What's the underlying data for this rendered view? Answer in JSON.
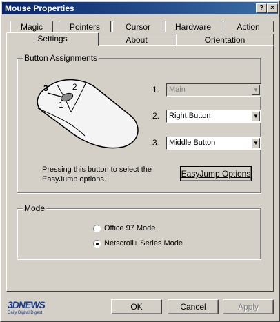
{
  "window": {
    "title": "Mouse Properties",
    "help_label": "?",
    "close_label": "×"
  },
  "tabs_top": [
    {
      "label": "Magic"
    },
    {
      "label": "Pointers"
    },
    {
      "label": "Cursor"
    },
    {
      "label": "Hardware"
    },
    {
      "label": "Action"
    }
  ],
  "tabs_bottom": [
    {
      "label": "Settings",
      "selected": true
    },
    {
      "label": "About"
    },
    {
      "label": "Orientation"
    }
  ],
  "button_assignments": {
    "title": "Button  Assignments",
    "mouse_labels": [
      "3",
      "2",
      "1"
    ],
    "rows": [
      {
        "number": "1.",
        "value": "Main",
        "enabled": false
      },
      {
        "number": "2.",
        "value": "Right Button",
        "enabled": true
      },
      {
        "number": "3.",
        "value": "Middle Button",
        "enabled": true
      }
    ],
    "description": "Pressing this button to select the EasyJump options.",
    "easyjump_label": "EasyJump Options"
  },
  "mode": {
    "title": "Mode",
    "options": [
      {
        "label": "Office 97 Mode",
        "selected": false
      },
      {
        "label": "Netscroll+ Series Mode",
        "selected": true
      }
    ]
  },
  "footer": {
    "logo_text": "3DNEWS",
    "logo_sub": "Daily Digital Digest",
    "ok_label": "OK",
    "cancel_label": "Cancel",
    "apply_label": "Apply"
  }
}
